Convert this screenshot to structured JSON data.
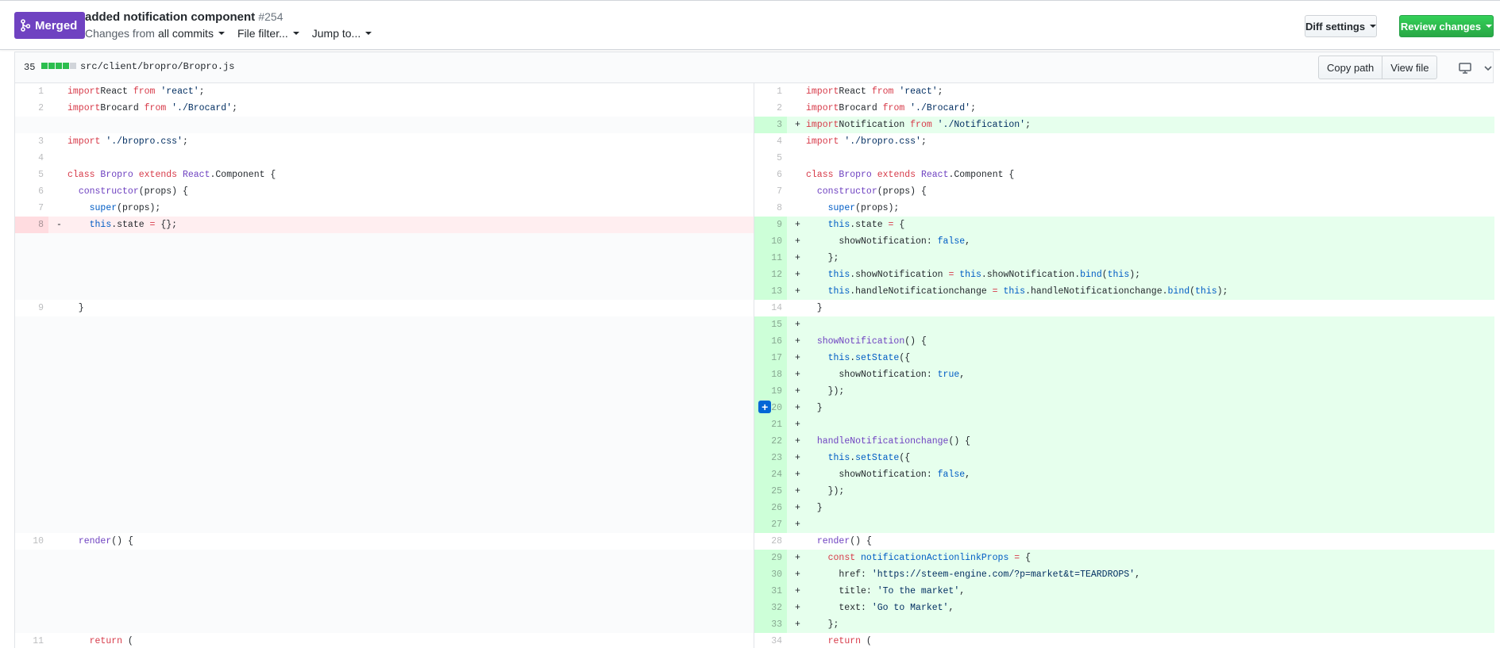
{
  "header": {
    "status_badge": "Merged",
    "title": "added notification component",
    "number": "#254",
    "changes_prefix": "Changes from",
    "changes_value": "all commits",
    "file_filter": "File filter...",
    "jump_to": "Jump to...",
    "diff_settings": "Diff settings",
    "review_changes": "Review changes"
  },
  "file": {
    "additions_count": "35",
    "path": "src/client/bropro/Bropro.js",
    "copy_path": "Copy path",
    "view_file": "View file"
  },
  "colors": {
    "merged": "#6f42c1",
    "review_green": "#28a745",
    "addition_bg": "#e6ffed",
    "deletion_bg": "#ffeef0",
    "keyword": "#d73a49",
    "string": "#032f62",
    "entity": "#6f42c1",
    "constant": "#005cc5"
  },
  "diff_rows": [
    {
      "l": {
        "n": "1",
        "t": "ctx",
        "c": [
          [
            "kw",
            "import"
          ],
          [
            "",
            "React "
          ],
          [
            "kw",
            "from"
          ],
          [
            "",
            " "
          ],
          [
            "str",
            "'react'"
          ],
          [
            "",
            ";"
          ]
        ]
      },
      "r": {
        "n": "1",
        "t": "ctx",
        "c": [
          [
            "kw",
            "import"
          ],
          [
            "",
            "React "
          ],
          [
            "kw",
            "from"
          ],
          [
            "",
            " "
          ],
          [
            "str",
            "'react'"
          ],
          [
            "",
            ";"
          ]
        ]
      }
    },
    {
      "l": {
        "n": "2",
        "t": "ctx",
        "c": [
          [
            "kw",
            "import"
          ],
          [
            "",
            "Brocard "
          ],
          [
            "kw",
            "from"
          ],
          [
            "",
            " "
          ],
          [
            "str",
            "'./Brocard'"
          ],
          [
            "",
            ";"
          ]
        ]
      },
      "r": {
        "n": "2",
        "t": "ctx",
        "c": [
          [
            "kw",
            "import"
          ],
          [
            "",
            "Brocard "
          ],
          [
            "kw",
            "from"
          ],
          [
            "",
            " "
          ],
          [
            "str",
            "'./Brocard'"
          ],
          [
            "",
            ";"
          ]
        ]
      }
    },
    {
      "l": {
        "t": "empty"
      },
      "r": {
        "n": "3",
        "t": "add",
        "m": "+",
        "c": [
          [
            "kw",
            "import"
          ],
          [
            "",
            "Notification "
          ],
          [
            "kw",
            "from"
          ],
          [
            "",
            " "
          ],
          [
            "str",
            "'./Notification'"
          ],
          [
            "",
            ";"
          ]
        ]
      }
    },
    {
      "l": {
        "n": "3",
        "t": "ctx",
        "c": [
          [
            "kw",
            "import"
          ],
          [
            "",
            " "
          ],
          [
            "str",
            "'./bropro.css'"
          ],
          [
            "",
            ";"
          ]
        ]
      },
      "r": {
        "n": "4",
        "t": "ctx",
        "c": [
          [
            "kw",
            "import"
          ],
          [
            "",
            " "
          ],
          [
            "str",
            "'./bropro.css'"
          ],
          [
            "",
            ";"
          ]
        ]
      }
    },
    {
      "l": {
        "n": "4",
        "t": "ctx",
        "c": []
      },
      "r": {
        "n": "5",
        "t": "ctx",
        "c": []
      }
    },
    {
      "l": {
        "n": "5",
        "t": "ctx",
        "c": [
          [
            "kw",
            "class"
          ],
          [
            "",
            " "
          ],
          [
            "ent",
            "Bropro"
          ],
          [
            "",
            " "
          ],
          [
            "kw",
            "extends"
          ],
          [
            "",
            " "
          ],
          [
            "ent",
            "React"
          ],
          [
            "",
            ".Component {"
          ]
        ]
      },
      "r": {
        "n": "6",
        "t": "ctx",
        "c": [
          [
            "kw",
            "class"
          ],
          [
            "",
            " "
          ],
          [
            "ent",
            "Bropro"
          ],
          [
            "",
            " "
          ],
          [
            "kw",
            "extends"
          ],
          [
            "",
            " "
          ],
          [
            "ent",
            "React"
          ],
          [
            "",
            ".Component {"
          ]
        ]
      }
    },
    {
      "l": {
        "n": "6",
        "t": "ctx",
        "c": [
          [
            "",
            "  "
          ],
          [
            "ent",
            "constructor"
          ],
          [
            "",
            "(props) {"
          ]
        ]
      },
      "r": {
        "n": "7",
        "t": "ctx",
        "c": [
          [
            "",
            "  "
          ],
          [
            "ent",
            "constructor"
          ],
          [
            "",
            "(props) {"
          ]
        ]
      }
    },
    {
      "l": {
        "n": "7",
        "t": "ctx",
        "c": [
          [
            "",
            "    "
          ],
          [
            "cst",
            "super"
          ],
          [
            "",
            "(props);"
          ]
        ]
      },
      "r": {
        "n": "8",
        "t": "ctx",
        "c": [
          [
            "",
            "    "
          ],
          [
            "cst",
            "super"
          ],
          [
            "",
            "(props);"
          ]
        ]
      }
    },
    {
      "l": {
        "n": "8",
        "t": "del",
        "m": "-",
        "c": [
          [
            "",
            "    "
          ],
          [
            "cst",
            "this"
          ],
          [
            "",
            ".state "
          ],
          [
            "kw",
            "="
          ],
          [
            "",
            " {};"
          ]
        ]
      },
      "r": {
        "n": "9",
        "t": "add",
        "m": "+",
        "c": [
          [
            "",
            "    "
          ],
          [
            "cst",
            "this"
          ],
          [
            "",
            ".state "
          ],
          [
            "kw",
            "="
          ],
          [
            "",
            " {"
          ]
        ]
      }
    },
    {
      "l": {
        "t": "empty"
      },
      "r": {
        "n": "10",
        "t": "add",
        "m": "+",
        "c": [
          [
            "",
            "      showNotification: "
          ],
          [
            "cst",
            "false"
          ],
          [
            "",
            ","
          ]
        ]
      }
    },
    {
      "l": {
        "t": "empty"
      },
      "r": {
        "n": "11",
        "t": "add",
        "m": "+",
        "c": [
          [
            "",
            "    };"
          ]
        ]
      }
    },
    {
      "l": {
        "t": "empty"
      },
      "r": {
        "n": "12",
        "t": "add",
        "m": "+",
        "c": [
          [
            "",
            "    "
          ],
          [
            "cst",
            "this"
          ],
          [
            "",
            ".showNotification "
          ],
          [
            "kw",
            "="
          ],
          [
            "",
            " "
          ],
          [
            "cst",
            "this"
          ],
          [
            "",
            ".showNotification."
          ],
          [
            "cst",
            "bind"
          ],
          [
            "",
            "("
          ],
          [
            "cst",
            "this"
          ],
          [
            "",
            ");"
          ]
        ]
      }
    },
    {
      "l": {
        "t": "empty"
      },
      "r": {
        "n": "13",
        "t": "add",
        "m": "+",
        "c": [
          [
            "",
            "    "
          ],
          [
            "cst",
            "this"
          ],
          [
            "",
            ".handleNotificationchange "
          ],
          [
            "kw",
            "="
          ],
          [
            "",
            " "
          ],
          [
            "cst",
            "this"
          ],
          [
            "",
            ".handleNotificationchange."
          ],
          [
            "cst",
            "bind"
          ],
          [
            "",
            "("
          ],
          [
            "cst",
            "this"
          ],
          [
            "",
            ");"
          ]
        ]
      }
    },
    {
      "l": {
        "n": "9",
        "t": "ctx",
        "c": [
          [
            "",
            "  }"
          ]
        ]
      },
      "r": {
        "n": "14",
        "t": "ctx",
        "c": [
          [
            "",
            "  }"
          ]
        ]
      }
    },
    {
      "l": {
        "t": "empty"
      },
      "r": {
        "n": "15",
        "t": "add",
        "m": "+",
        "c": []
      }
    },
    {
      "l": {
        "t": "empty"
      },
      "r": {
        "n": "16",
        "t": "add",
        "m": "+",
        "c": [
          [
            "",
            "  "
          ],
          [
            "ent",
            "showNotification"
          ],
          [
            "",
            "() {"
          ]
        ]
      }
    },
    {
      "l": {
        "t": "empty"
      },
      "r": {
        "n": "17",
        "t": "add",
        "m": "+",
        "c": [
          [
            "",
            "    "
          ],
          [
            "cst",
            "this"
          ],
          [
            "",
            "."
          ],
          [
            "cst",
            "setState"
          ],
          [
            "",
            "({"
          ]
        ]
      }
    },
    {
      "l": {
        "t": "empty"
      },
      "r": {
        "n": "18",
        "t": "add",
        "m": "+",
        "c": [
          [
            "",
            "      showNotification: "
          ],
          [
            "cst",
            "true"
          ],
          [
            "",
            ","
          ]
        ]
      }
    },
    {
      "l": {
        "t": "empty"
      },
      "r": {
        "n": "19",
        "t": "add",
        "m": "+",
        "c": [
          [
            "",
            "    });"
          ]
        ]
      }
    },
    {
      "l": {
        "t": "empty"
      },
      "r": {
        "n": "20",
        "t": "add",
        "m": "+",
        "plus": true,
        "c": [
          [
            "",
            "  }"
          ]
        ]
      }
    },
    {
      "l": {
        "t": "empty"
      },
      "r": {
        "n": "21",
        "t": "add",
        "m": "+",
        "c": []
      }
    },
    {
      "l": {
        "t": "empty"
      },
      "r": {
        "n": "22",
        "t": "add",
        "m": "+",
        "c": [
          [
            "",
            "  "
          ],
          [
            "ent",
            "handleNotificationchange"
          ],
          [
            "",
            "() {"
          ]
        ]
      }
    },
    {
      "l": {
        "t": "empty"
      },
      "r": {
        "n": "23",
        "t": "add",
        "m": "+",
        "c": [
          [
            "",
            "    "
          ],
          [
            "cst",
            "this"
          ],
          [
            "",
            "."
          ],
          [
            "cst",
            "setState"
          ],
          [
            "",
            "({"
          ]
        ]
      }
    },
    {
      "l": {
        "t": "empty"
      },
      "r": {
        "n": "24",
        "t": "add",
        "m": "+",
        "c": [
          [
            "",
            "      showNotification: "
          ],
          [
            "cst",
            "false"
          ],
          [
            "",
            ","
          ]
        ]
      }
    },
    {
      "l": {
        "t": "empty"
      },
      "r": {
        "n": "25",
        "t": "add",
        "m": "+",
        "c": [
          [
            "",
            "    });"
          ]
        ]
      }
    },
    {
      "l": {
        "t": "empty"
      },
      "r": {
        "n": "26",
        "t": "add",
        "m": "+",
        "c": [
          [
            "",
            "  }"
          ]
        ]
      }
    },
    {
      "l": {
        "t": "empty"
      },
      "r": {
        "n": "27",
        "t": "add",
        "m": "+",
        "c": []
      }
    },
    {
      "l": {
        "n": "10",
        "t": "ctx",
        "c": [
          [
            "",
            "  "
          ],
          [
            "ent",
            "render"
          ],
          [
            "",
            "() {"
          ]
        ]
      },
      "r": {
        "n": "28",
        "t": "ctx",
        "c": [
          [
            "",
            "  "
          ],
          [
            "ent",
            "render"
          ],
          [
            "",
            "() {"
          ]
        ]
      }
    },
    {
      "l": {
        "t": "empty"
      },
      "r": {
        "n": "29",
        "t": "add",
        "m": "+",
        "c": [
          [
            "",
            "    "
          ],
          [
            "kw",
            "const"
          ],
          [
            "",
            " "
          ],
          [
            "cst",
            "notificationActionlinkProps"
          ],
          [
            "",
            " "
          ],
          [
            "kw",
            "="
          ],
          [
            "",
            " {"
          ]
        ]
      }
    },
    {
      "l": {
        "t": "empty"
      },
      "r": {
        "n": "30",
        "t": "add",
        "m": "+",
        "c": [
          [
            "",
            "      href: "
          ],
          [
            "str",
            "'https://steem-engine.com/?p=market&t=TEARDROPS'"
          ],
          [
            "",
            ","
          ]
        ]
      }
    },
    {
      "l": {
        "t": "empty"
      },
      "r": {
        "n": "31",
        "t": "add",
        "m": "+",
        "c": [
          [
            "",
            "      title: "
          ],
          [
            "str",
            "'To the market'"
          ],
          [
            "",
            ","
          ]
        ]
      }
    },
    {
      "l": {
        "t": "empty"
      },
      "r": {
        "n": "32",
        "t": "add",
        "m": "+",
        "c": [
          [
            "",
            "      text: "
          ],
          [
            "str",
            "'Go to Market'"
          ],
          [
            "",
            ","
          ]
        ]
      }
    },
    {
      "l": {
        "t": "empty"
      },
      "r": {
        "n": "33",
        "t": "add",
        "m": "+",
        "c": [
          [
            "",
            "    };"
          ]
        ]
      }
    },
    {
      "l": {
        "n": "11",
        "t": "ctx",
        "c": [
          [
            "",
            "    "
          ],
          [
            "kw",
            "return"
          ],
          [
            "",
            " ("
          ]
        ]
      },
      "r": {
        "n": "34",
        "t": "ctx",
        "c": [
          [
            "",
            "    "
          ],
          [
            "kw",
            "return"
          ],
          [
            "",
            " ("
          ]
        ]
      }
    }
  ]
}
